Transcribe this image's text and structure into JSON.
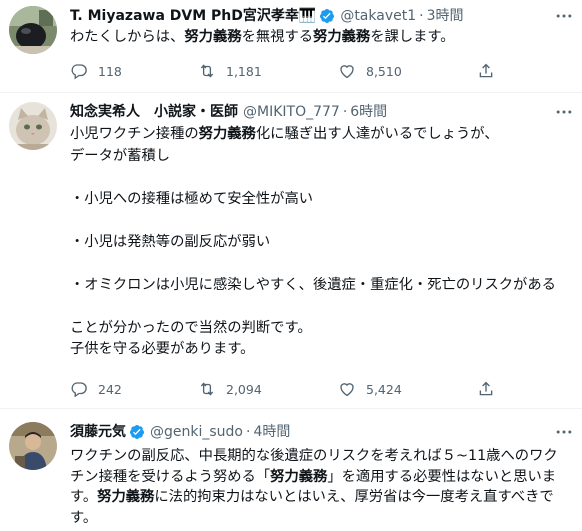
{
  "tweets": [
    {
      "name": "T. Miyazawa DVM PhD宮沢孝幸🎹",
      "verified": true,
      "handle": "@takavet1",
      "time": "3時間",
      "text_parts": [
        {
          "t": "わたくしからは、",
          "b": false
        },
        {
          "t": "努力義務",
          "b": true
        },
        {
          "t": "を無視する",
          "b": false
        },
        {
          "t": "努力義務",
          "b": true
        },
        {
          "t": "を課します。",
          "b": false
        }
      ],
      "reply_count": "118",
      "retweet_count": "1,181",
      "like_count": "8,510"
    },
    {
      "name": "知念実希人　小説家・医師",
      "verified": false,
      "handle": "@MIKITO_777",
      "time": "6時間",
      "text_parts": [
        {
          "t": "小児ワクチン接種の",
          "b": false
        },
        {
          "t": "努力義務",
          "b": true
        },
        {
          "t": "化に騒ぎ出す人達がいるでしょうが、\nデータが蓄積し\n\n・小児への接種は極めて安全性が高い\n\n・小児は発熱等の副反応が弱い\n\n・オミクロンは小児に感染しやすく、後遺症・重症化・死亡のリスクがある\n\nことが分かったので当然の判断です。\n子供を守る必要があります。",
          "b": false
        }
      ],
      "reply_count": "242",
      "retweet_count": "2,094",
      "like_count": "5,424"
    },
    {
      "name": "須藤元気",
      "verified": true,
      "handle": "@genki_sudo",
      "time": "4時間",
      "text_parts": [
        {
          "t": "ワクチンの副反応、中長期的な後遺症のリスクを考えれば５~11歳へのワクチン接種を受けるよう努める「",
          "b": false
        },
        {
          "t": "努力義務",
          "b": true
        },
        {
          "t": "」を適用する必要性はないと思います。",
          "b": false
        },
        {
          "t": "努力義務",
          "b": true
        },
        {
          "t": "に法的拘束力はないとはいえ、厚労省は今一度考え直すべきです。",
          "b": false
        }
      ]
    }
  ],
  "icons": {
    "reply": "reply-icon",
    "retweet": "retweet-icon",
    "like": "heart-icon",
    "share": "share-icon",
    "more": "more-icon",
    "verified": "verified-badge-icon"
  },
  "colors": {
    "verified": "#1d9bf0",
    "secondary_text": "#536471",
    "divider": "#eff3f4"
  }
}
